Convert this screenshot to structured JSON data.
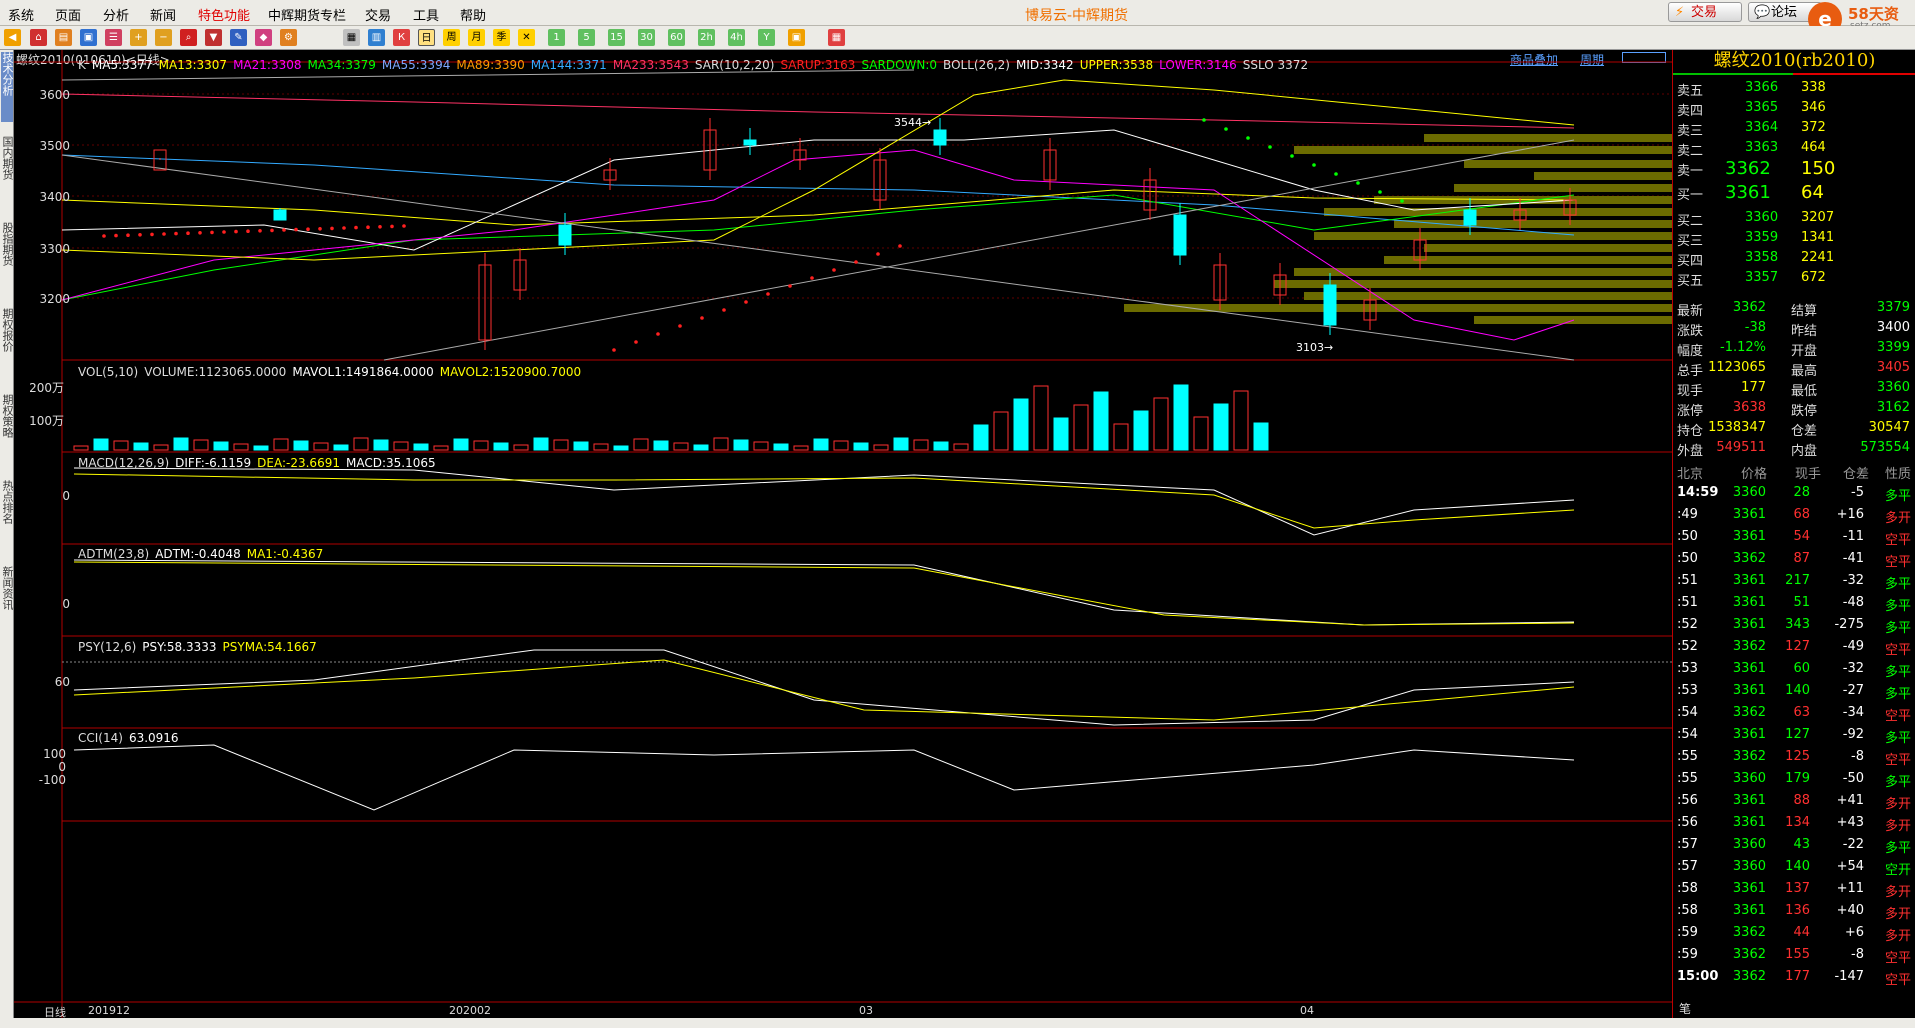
{
  "menubar": {
    "items": [
      "系统",
      "页面",
      "分析",
      "新闻",
      "特色功能",
      "中辉期货专栏",
      "交易",
      "工具",
      "帮助"
    ],
    "title": "博易云-中辉期货",
    "trade_label": "交易",
    "forum_label": "论坛",
    "logo_char": "e",
    "logo_text": "58天资",
    "logo_sub": "setz.com"
  },
  "toolbar": {
    "period_buttons": [
      "1",
      "5",
      "15",
      "30",
      "60",
      "2h",
      "4h",
      "Y"
    ]
  },
  "left_tabs": [
    "技术分析",
    "国内期货",
    "股指期货",
    "期权报价",
    "期权策略",
    "热点排名",
    "新闻资讯"
  ],
  "chart": {
    "symbol_info": "螺纹2010(010610)<日线>",
    "link_overlay": "商品叠加",
    "link_period": "周期",
    "main_legend": [
      {
        "t": "K",
        "c": "#dddddd"
      },
      {
        "t": "MA5:3377",
        "c": "#ffffff"
      },
      {
        "t": "MA13:3307",
        "c": "#ffff00"
      },
      {
        "t": "MA21:3308",
        "c": "#ff00ff"
      },
      {
        "t": "MA34:3379",
        "c": "#00ff00"
      },
      {
        "t": "MA55:3394",
        "c": "#7da7ff"
      },
      {
        "t": "MA89:3390",
        "c": "#ff9900"
      },
      {
        "t": "MA144:3371",
        "c": "#33aaff"
      },
      {
        "t": "MA233:3543",
        "c": "#ff3366"
      },
      {
        "t": "SAR(10,2,20)",
        "c": "#dddddd"
      },
      {
        "t": "SARUP:3163",
        "c": "#ff2020"
      },
      {
        "t": "SARDOWN:0",
        "c": "#00ff00"
      },
      {
        "t": "BOLL(26,2)",
        "c": "#dddddd"
      },
      {
        "t": "MID:3342",
        "c": "#ffffff"
      },
      {
        "t": "UPPER:3538",
        "c": "#ffff00"
      },
      {
        "t": "LOWER:3146",
        "c": "#ff00ff"
      },
      {
        "t": "SSLO 3372",
        "c": "#dddddd"
      }
    ],
    "price_labels": [
      "3600",
      "3500",
      "3400",
      "3300",
      "3200"
    ],
    "high_annotation": "3544→",
    "low_annotation": "3103→",
    "vol_legend": [
      {
        "t": "VOL(5,10)",
        "c": "#dddddd"
      },
      {
        "t": "VOLUME:1123065.0000",
        "c": "#dddddd"
      },
      {
        "t": "MAVOL1:1491864.0000",
        "c": "#ffffff"
      },
      {
        "t": "MAVOL2:1520900.7000",
        "c": "#ffff00"
      }
    ],
    "vol_labels": [
      "200万",
      "100万"
    ],
    "macd_legend": [
      {
        "t": "MACD(12,26,9)",
        "c": "#dddddd"
      },
      {
        "t": "DIFF:-6.1159",
        "c": "#ffffff"
      },
      {
        "t": "DEA:-23.6691",
        "c": "#ffff00"
      },
      {
        "t": "MACD:35.1065",
        "c": "#ffffff"
      }
    ],
    "macd_labels": [
      "0"
    ],
    "adtm_legend": [
      {
        "t": "ADTM(23,8)",
        "c": "#dddddd"
      },
      {
        "t": "ADTM:-0.4048",
        "c": "#ffffff"
      },
      {
        "t": "MA1:-0.4367",
        "c": "#ffff00"
      }
    ],
    "adtm_labels": [
      "0"
    ],
    "psy_legend": [
      {
        "t": "PSY(12,6)",
        "c": "#dddddd"
      },
      {
        "t": "PSY:58.3333",
        "c": "#ffffff"
      },
      {
        "t": "PSYMA:54.1667",
        "c": "#ffff00"
      }
    ],
    "psy_labels": [
      "60"
    ],
    "cci_legend": [
      {
        "t": "CCI(14)",
        "c": "#dddddd"
      },
      {
        "t": "63.0916",
        "c": "#ffffff"
      }
    ],
    "cci_labels": [
      "100",
      "0",
      "-100"
    ],
    "x_labels": [
      "201912",
      "202002",
      "03",
      "04"
    ],
    "period_label": "日线"
  },
  "quote": {
    "title": "螺纹2010(rb2010)",
    "asks": [
      {
        "label": "卖五",
        "price": "3366",
        "vol": "338"
      },
      {
        "label": "卖四",
        "price": "3365",
        "vol": "346"
      },
      {
        "label": "卖三",
        "price": "3364",
        "vol": "372"
      },
      {
        "label": "卖二",
        "price": "3363",
        "vol": "464"
      },
      {
        "label": "卖一",
        "price": "3362",
        "vol": "150"
      }
    ],
    "bids": [
      {
        "label": "买一",
        "price": "3361",
        "vol": "64"
      },
      {
        "label": "买二",
        "price": "3360",
        "vol": "3207"
      },
      {
        "label": "买三",
        "price": "3359",
        "vol": "1341"
      },
      {
        "label": "买四",
        "price": "3358",
        "vol": "2241"
      },
      {
        "label": "买五",
        "price": "3357",
        "vol": "672"
      }
    ],
    "stats": [
      {
        "l1": "最新",
        "v1": "3362",
        "c1": "#00ff00",
        "l2": "结算",
        "v2": "3379",
        "c2": "#00ff00"
      },
      {
        "l1": "涨跌",
        "v1": "-38",
        "c1": "#00ff00",
        "l2": "昨结",
        "v2": "3400",
        "c2": "#ffffff"
      },
      {
        "l1": "幅度",
        "v1": "-1.12%",
        "c1": "#00ff00",
        "l2": "开盘",
        "v2": "3399",
        "c2": "#00ff00"
      },
      {
        "l1": "总手",
        "v1": "1123065",
        "c1": "#ffff00",
        "l2": "最高",
        "v2": "3405",
        "c2": "#ff3030"
      },
      {
        "l1": "现手",
        "v1": "177",
        "c1": "#ffff00",
        "l2": "最低",
        "v2": "3360",
        "c2": "#00ff00"
      },
      {
        "l1": "涨停",
        "v1": "3638",
        "c1": "#ff3030",
        "l2": "跌停",
        "v2": "3162",
        "c2": "#00ff00"
      },
      {
        "l1": "持仓",
        "v1": "1538347",
        "c1": "#ffff00",
        "l2": "仓差",
        "v2": "30547",
        "c2": "#ffff00"
      },
      {
        "l1": "外盘",
        "v1": "549511",
        "c1": "#ff3030",
        "l2": "内盘",
        "v2": "573554",
        "c2": "#00ff00"
      }
    ],
    "tick_headers": [
      "北京",
      "价格",
      "现手",
      "仓差",
      "性质"
    ],
    "ticks": [
      {
        "t": "14:59",
        "p": "3360",
        "v": "28",
        "d": "-5",
        "n": "多平",
        "pc": "#00ff00",
        "vc": "#00ff00",
        "dc": "#ffffff",
        "nc": "#00ff00"
      },
      {
        "t": ":49",
        "p": "3361",
        "v": "68",
        "d": "+16",
        "n": "多开",
        "pc": "#00ff00",
        "vc": "#ff3030",
        "dc": "#ffffff",
        "nc": "#ff3030"
      },
      {
        "t": ":50",
        "p": "3361",
        "v": "54",
        "d": "-11",
        "n": "空平",
        "pc": "#00ff00",
        "vc": "#ff3030",
        "dc": "#ffffff",
        "nc": "#ff3030"
      },
      {
        "t": ":50",
        "p": "3362",
        "v": "87",
        "d": "-41",
        "n": "空平",
        "pc": "#00ff00",
        "vc": "#ff3030",
        "dc": "#ffffff",
        "nc": "#ff3030"
      },
      {
        "t": ":51",
        "p": "3361",
        "v": "217",
        "d": "-32",
        "n": "多平",
        "pc": "#00ff00",
        "vc": "#00ff00",
        "dc": "#ffffff",
        "nc": "#00ff00"
      },
      {
        "t": ":51",
        "p": "3361",
        "v": "51",
        "d": "-48",
        "n": "多平",
        "pc": "#00ff00",
        "vc": "#00ff00",
        "dc": "#ffffff",
        "nc": "#00ff00"
      },
      {
        "t": ":52",
        "p": "3361",
        "v": "343",
        "d": "-275",
        "n": "多平",
        "pc": "#00ff00",
        "vc": "#00ff00",
        "dc": "#ffffff",
        "nc": "#00ff00"
      },
      {
        "t": ":52",
        "p": "3362",
        "v": "127",
        "d": "-49",
        "n": "空平",
        "pc": "#00ff00",
        "vc": "#ff3030",
        "dc": "#ffffff",
        "nc": "#ff3030"
      },
      {
        "t": ":53",
        "p": "3361",
        "v": "60",
        "d": "-32",
        "n": "多平",
        "pc": "#00ff00",
        "vc": "#00ff00",
        "dc": "#ffffff",
        "nc": "#00ff00"
      },
      {
        "t": ":53",
        "p": "3361",
        "v": "140",
        "d": "-27",
        "n": "多平",
        "pc": "#00ff00",
        "vc": "#00ff00",
        "dc": "#ffffff",
        "nc": "#00ff00"
      },
      {
        "t": ":54",
        "p": "3362",
        "v": "63",
        "d": "-34",
        "n": "空平",
        "pc": "#00ff00",
        "vc": "#ff3030",
        "dc": "#ffffff",
        "nc": "#ff3030"
      },
      {
        "t": ":54",
        "p": "3361",
        "v": "127",
        "d": "-92",
        "n": "多平",
        "pc": "#00ff00",
        "vc": "#00ff00",
        "dc": "#ffffff",
        "nc": "#00ff00"
      },
      {
        "t": ":55",
        "p": "3362",
        "v": "125",
        "d": "-8",
        "n": "空平",
        "pc": "#00ff00",
        "vc": "#ff3030",
        "dc": "#ffffff",
        "nc": "#ff3030"
      },
      {
        "t": ":55",
        "p": "3360",
        "v": "179",
        "d": "-50",
        "n": "多平",
        "pc": "#00ff00",
        "vc": "#00ff00",
        "dc": "#ffffff",
        "nc": "#00ff00"
      },
      {
        "t": ":56",
        "p": "3361",
        "v": "88",
        "d": "+41",
        "n": "多开",
        "pc": "#00ff00",
        "vc": "#ff3030",
        "dc": "#ffffff",
        "nc": "#ff3030"
      },
      {
        "t": ":56",
        "p": "3361",
        "v": "134",
        "d": "+43",
        "n": "多开",
        "pc": "#00ff00",
        "vc": "#ff3030",
        "dc": "#ffffff",
        "nc": "#ff3030"
      },
      {
        "t": ":57",
        "p": "3360",
        "v": "43",
        "d": "-22",
        "n": "多平",
        "pc": "#00ff00",
        "vc": "#00ff00",
        "dc": "#ffffff",
        "nc": "#00ff00"
      },
      {
        "t": ":57",
        "p": "3360",
        "v": "140",
        "d": "+54",
        "n": "空开",
        "pc": "#00ff00",
        "vc": "#00ff00",
        "dc": "#ffffff",
        "nc": "#00ff00"
      },
      {
        "t": ":58",
        "p": "3361",
        "v": "137",
        "d": "+11",
        "n": "多开",
        "pc": "#00ff00",
        "vc": "#ff3030",
        "dc": "#ffffff",
        "nc": "#ff3030"
      },
      {
        "t": ":58",
        "p": "3361",
        "v": "136",
        "d": "+40",
        "n": "多开",
        "pc": "#00ff00",
        "vc": "#ff3030",
        "dc": "#ffffff",
        "nc": "#ff3030"
      },
      {
        "t": ":59",
        "p": "3362",
        "v": "44",
        "d": "+6",
        "n": "多开",
        "pc": "#00ff00",
        "vc": "#ff3030",
        "dc": "#ffffff",
        "nc": "#ff3030"
      },
      {
        "t": ":59",
        "p": "3362",
        "v": "155",
        "d": "-8",
        "n": "空平",
        "pc": "#00ff00",
        "vc": "#ff3030",
        "dc": "#ffffff",
        "nc": "#ff3030"
      },
      {
        "t": "15:00",
        "p": "3362",
        "v": "177",
        "d": "-147",
        "n": "空平",
        "pc": "#00ff00",
        "vc": "#ff3030",
        "dc": "#ffffff",
        "nc": "#ff3030"
      }
    ],
    "footer_label": "笔"
  },
  "colors": {
    "up": "#ff3030",
    "down": "#00ffff",
    "grid": "#8b0000",
    "bg": "#000000"
  }
}
